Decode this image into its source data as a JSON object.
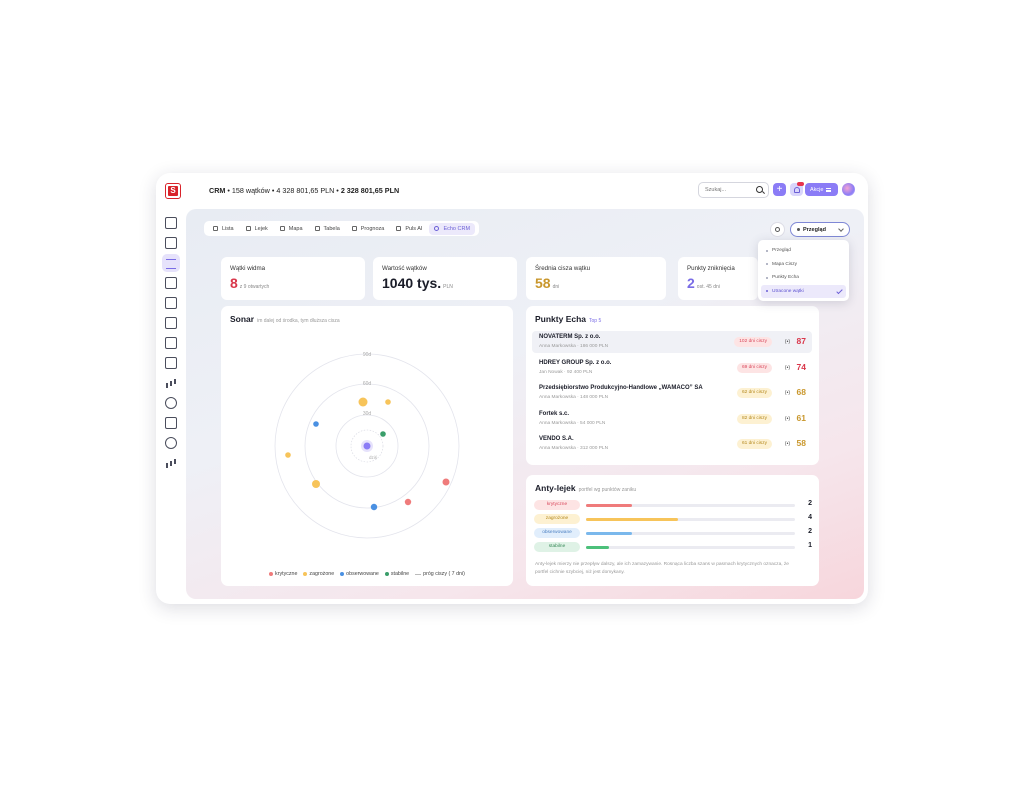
{
  "topbar": {
    "crumb_app": "CRM",
    "crumb_rest": " • 158 wątków • 4 328 801,65 PLN • ",
    "crumb_total": "2 328 801,65 PLN",
    "search_placeholder": "Szukaj...",
    "plus_label": "+",
    "akcje_label": "Akcje"
  },
  "sidebar": {
    "icons": [
      "dashboard-icon",
      "document-icon",
      "list-icon",
      "copy-icon",
      "book-icon",
      "clipboard-icon",
      "calendar-icon",
      "folder-icon",
      "chart-icon",
      "settings-icon",
      "mail-icon",
      "ai-icon",
      "stats-icon"
    ],
    "avatar_initials": "JM"
  },
  "tabs": [
    {
      "label": "Lista",
      "icon": "list-icon"
    },
    {
      "label": "Lejek",
      "icon": "funnel-icon"
    },
    {
      "label": "Mapa",
      "icon": "map-icon"
    },
    {
      "label": "Tabela",
      "icon": "table-icon"
    },
    {
      "label": "Prognoza",
      "icon": "forecast-icon"
    },
    {
      "label": "Puls AI",
      "icon": "sparkle-icon"
    },
    {
      "label": "Echo CRM",
      "icon": "sparkle-icon",
      "active": true
    }
  ],
  "view_select": {
    "value": "Przegląd",
    "options": [
      "Przegląd",
      "Mapa Ciszy",
      "Punkty Echa",
      "Utracone wątki"
    ],
    "active_option": "Utracone wątki"
  },
  "kpis": [
    {
      "label": "Wątki widma",
      "value": "8",
      "sub": "z 9 otwartych",
      "color": "#d9364a"
    },
    {
      "label": "Wartość wątków",
      "value": "1040 tys.",
      "sub": "PLN",
      "color": "#1a1c28"
    },
    {
      "label": "Średnia cisza wątku",
      "value": "58",
      "sub": "dni",
      "color": "#c9972c"
    },
    {
      "label": "Punkty zniknięcia",
      "value": "2",
      "sub": "ost. 45 dni",
      "color": "#7a6ce6"
    }
  ],
  "sonar": {
    "title": "Sonar",
    "subtitle": "im dalej od środka, tym dłuższa cisza",
    "ring_labels": [
      "90d",
      "60d",
      "30d",
      "dziś"
    ],
    "legend": [
      "krytyczne",
      "zagrożone",
      "obserwowane",
      "stabilne",
      "próg ciszy ( 7 dni)"
    ]
  },
  "echo": {
    "title": "Punkty Echa",
    "subtitle": "Top 5",
    "rows": [
      {
        "name": "NOVATERM Sp. z o.o.",
        "meta": "Anna Markowska · 186 000 PLN",
        "badge": "102 dni ciszy",
        "score": "87",
        "level": "red"
      },
      {
        "name": "HDREY GROUP Sp. z o.o.",
        "meta": "Jan Nowak · 92 400 PLN",
        "badge": "69 dni ciszy",
        "score": "74",
        "level": "red"
      },
      {
        "name": "Przedsiębiorstwo Produkcyjno-Handlowe „WAMACO” SA",
        "meta": "Anna Markowska · 148 000 PLN",
        "badge": "62 dni ciszy",
        "score": "68",
        "level": "yellow"
      },
      {
        "name": "Fortek s.c.",
        "meta": "Anna Markowska · 54 000 PLN",
        "badge": "82 dni ciszy",
        "score": "61",
        "level": "yellow"
      },
      {
        "name": "VENDO S.A.",
        "meta": "Anna Markowska · 312 000 PLN",
        "badge": "61 dni ciszy",
        "score": "58",
        "level": "yellow"
      }
    ],
    "radar_glyph": "(•)"
  },
  "antylejek": {
    "title": "Anty-lejek",
    "subtitle": "portfel wg punktów zaniku",
    "rows": [
      {
        "label": "krytyczne",
        "count": "2",
        "fraction": 0.22
      },
      {
        "label": "zagrożone",
        "count": "4",
        "fraction": 0.44
      },
      {
        "label": "obserwowane",
        "count": "2",
        "fraction": 0.22
      },
      {
        "label": "stabilne",
        "count": "1",
        "fraction": 0.11
      }
    ],
    "note": "Anty-lejek mierzy nie przepływ dalszy, ale ich zamazywanie. Rosnąca liczba szans w pasmach krytycznych oznacza, że portfel cichnie szybciej, niż jest domykany."
  },
  "colors": {
    "critical": "#ef7b7b",
    "threatened": "#f7c45a",
    "observed": "#4a90e2",
    "stable": "#3a9e6a",
    "accent": "#8b7cf6"
  }
}
